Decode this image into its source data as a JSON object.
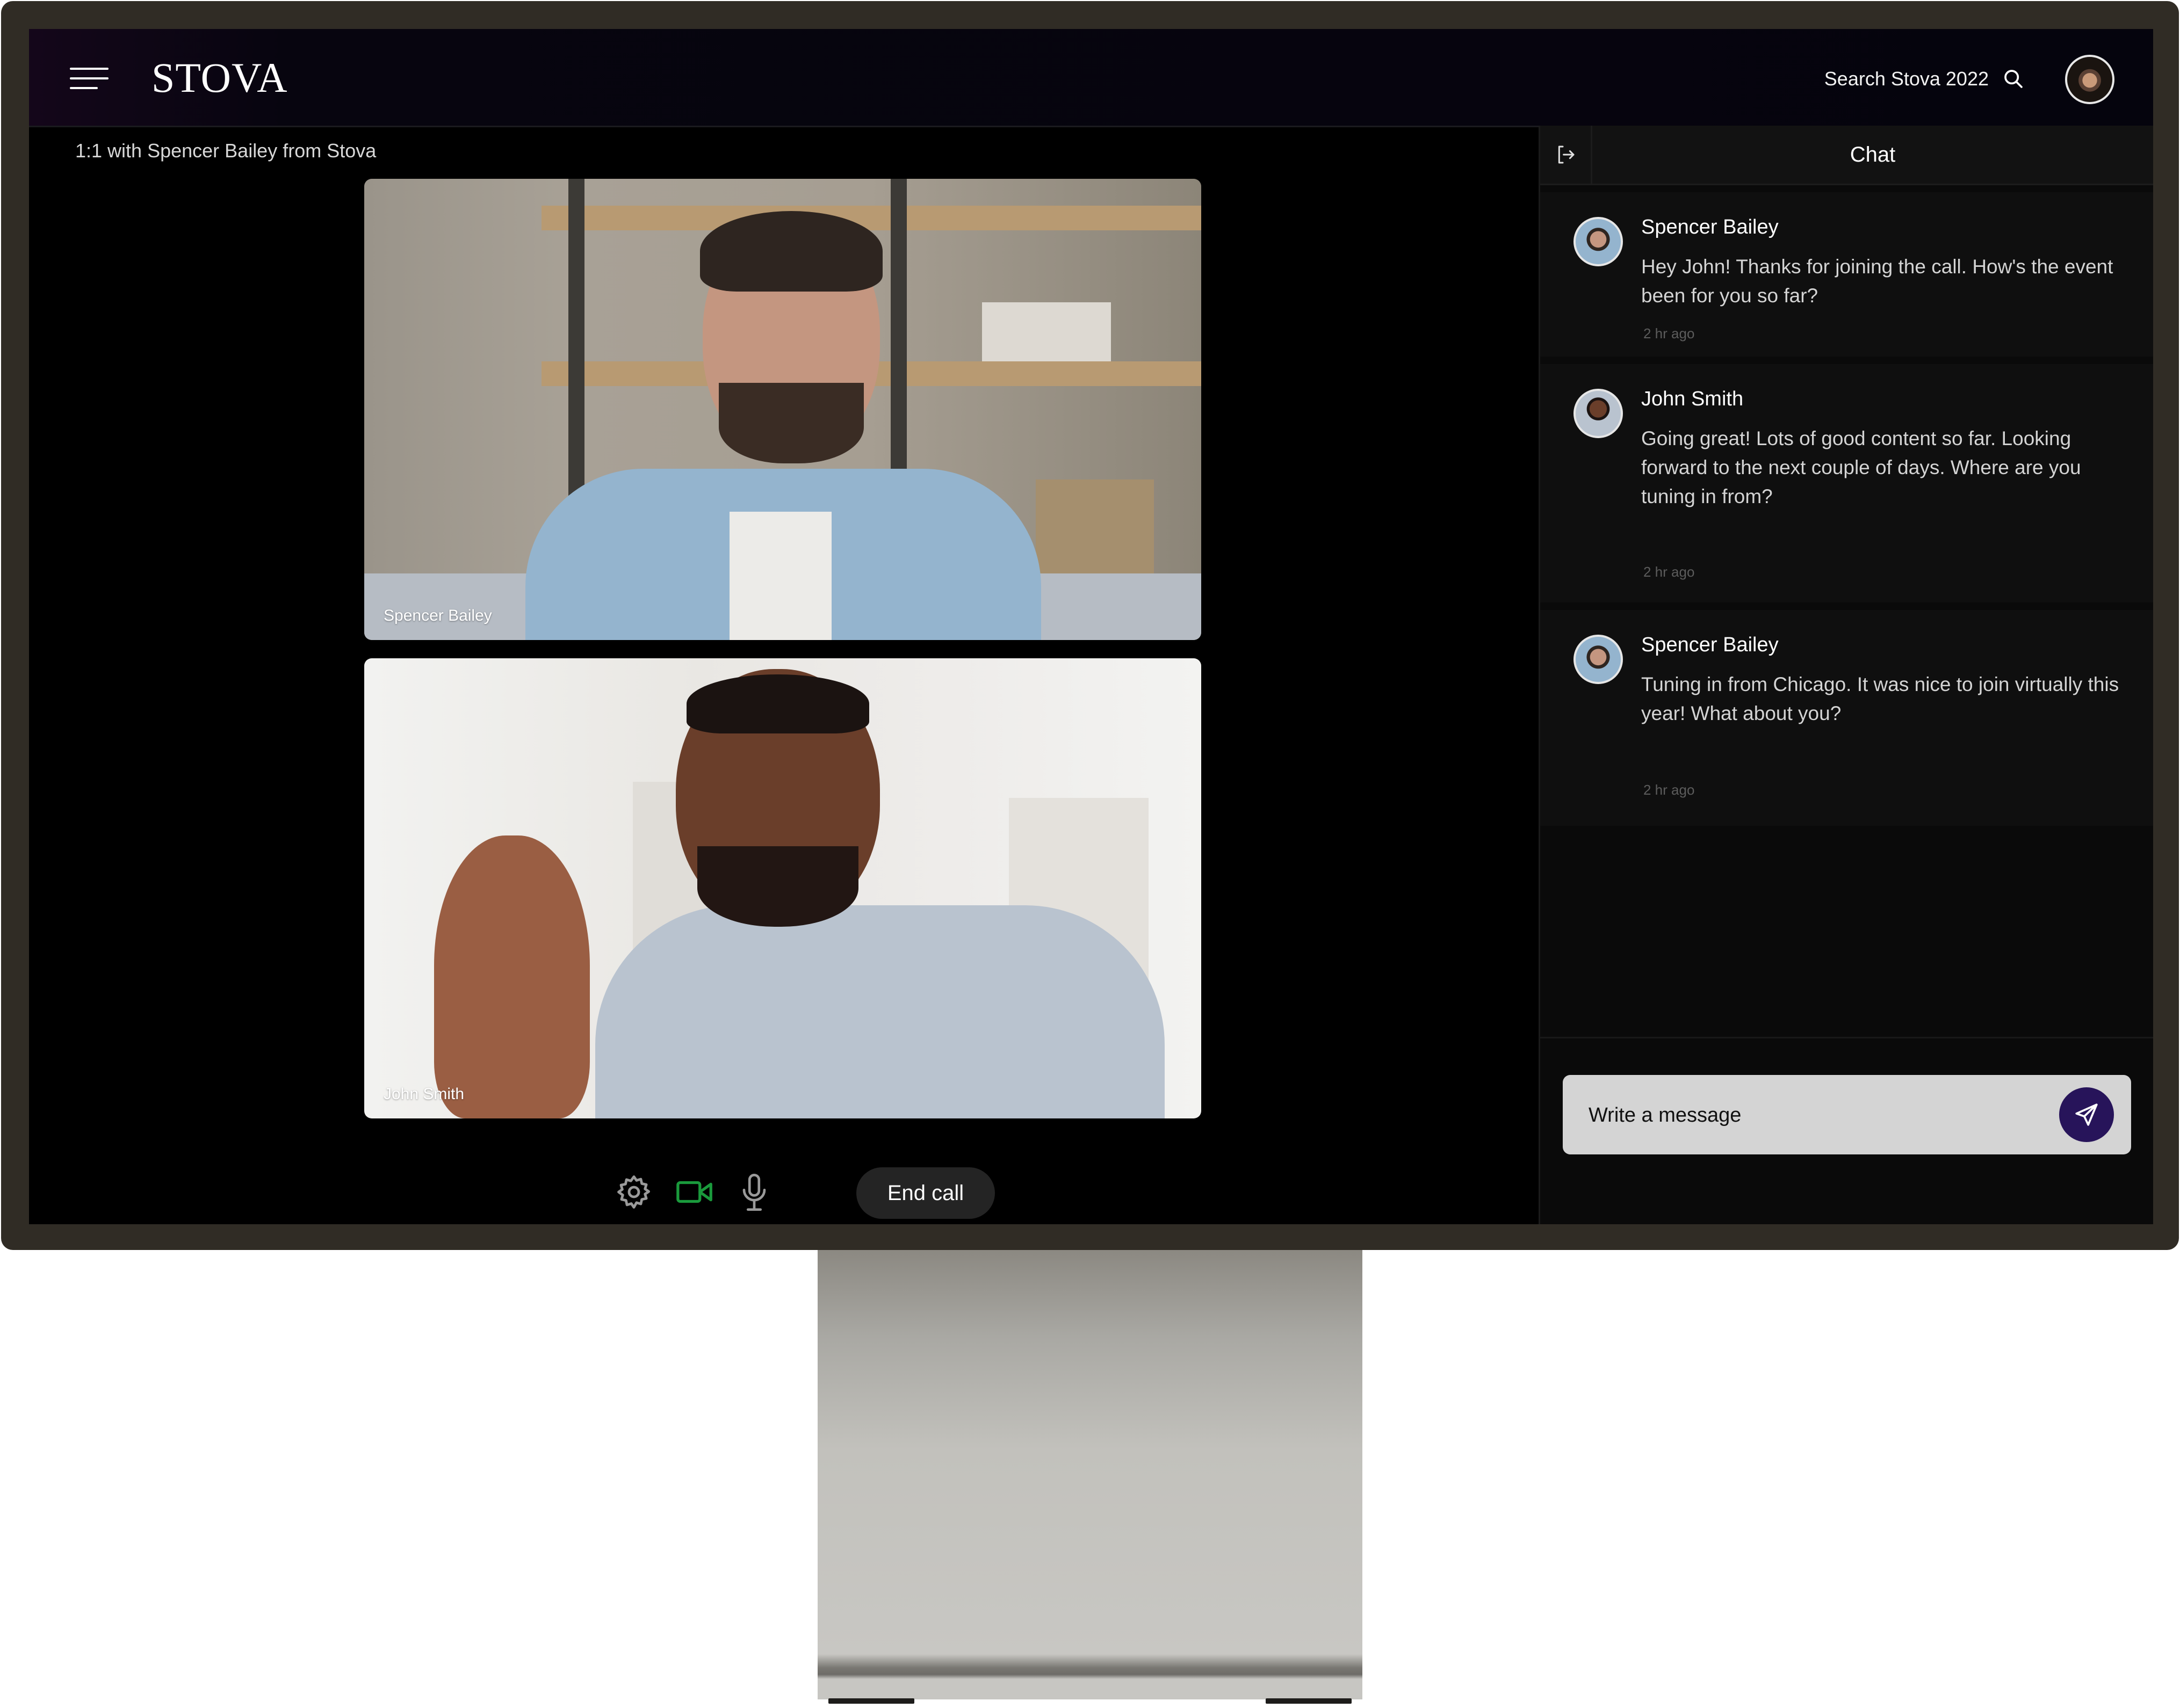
{
  "app": {
    "logo": "STOVA",
    "search_label": "Search Stova 2022",
    "user_avatar_alt": "Current user avatar"
  },
  "call": {
    "title": "1:1 with Spencer Bailey from Stova",
    "participants": [
      {
        "name": "Spencer Bailey"
      },
      {
        "name": "John Smith"
      }
    ],
    "controls": {
      "settings_icon": "gear-icon",
      "video_icon": "video-camera-icon",
      "video_active": true,
      "mic_icon": "microphone-icon",
      "end_call_label": "End call"
    },
    "colors": {
      "video_active": "#1a9a3c",
      "icon_inactive": "#9a9a9a"
    }
  },
  "chat": {
    "title": "Chat",
    "exit_icon": "exit-panel-icon",
    "messages": [
      {
        "author": "Spencer Bailey",
        "text": "Hey John! Thanks for joining the call. How's the event been for you so far?",
        "time": "2 hr ago"
      },
      {
        "author": "John Smith",
        "text": "Going great! Lots of good content so far. Looking forward to the next couple of days. Where are you tuning in from?",
        "time": "2 hr ago"
      },
      {
        "author": "Spencer Bailey",
        "text": "Tuning in from Chicago. It was nice to join virtually this year! What about you?",
        "time": "2 hr ago"
      }
    ],
    "composer": {
      "placeholder": "Write a message",
      "value": "",
      "send_icon": "paper-plane-icon"
    },
    "colors": {
      "send_button": "#27145a"
    }
  }
}
